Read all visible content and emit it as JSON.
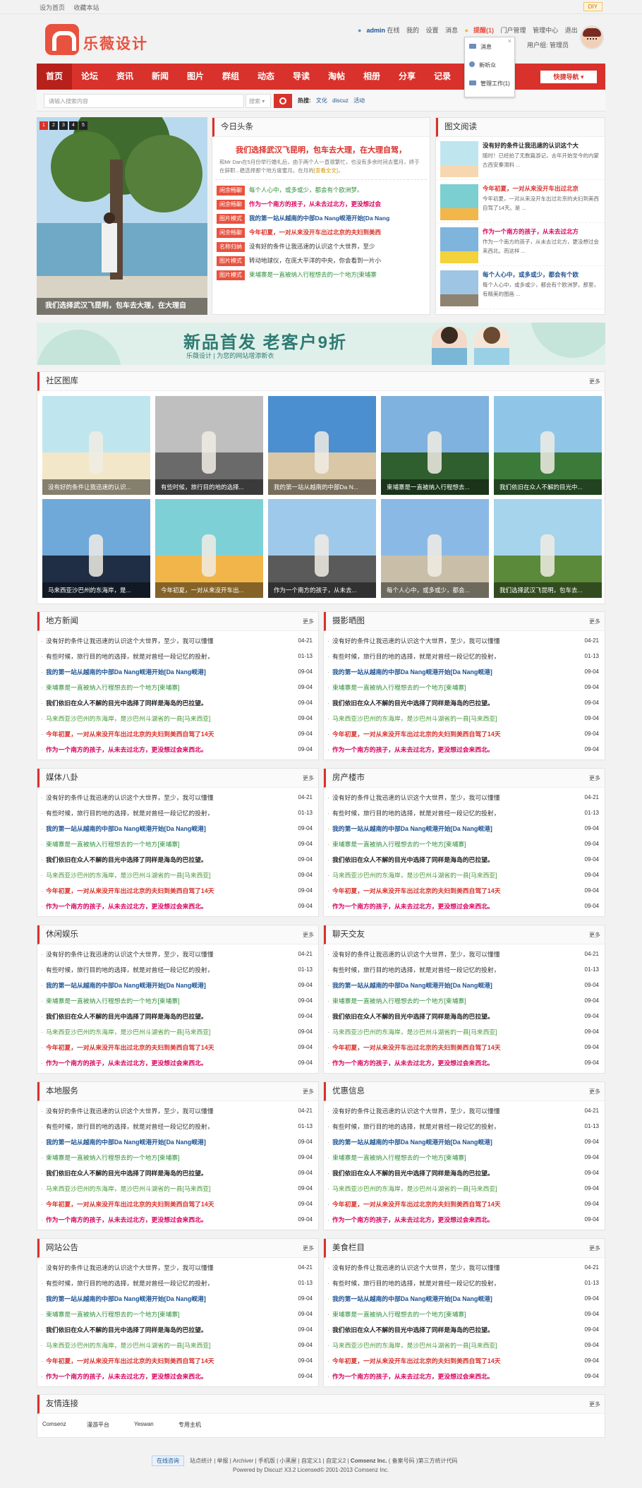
{
  "topbar": {
    "set_home": "设为首页",
    "bookmark": "收藏本站",
    "diy": "DIY"
  },
  "header": {
    "logo_text": "乐薇设计",
    "user": "admin",
    "online": "在线",
    "menu": [
      "我的",
      "设置",
      "消息"
    ],
    "remind": "提醒(1)",
    "manage": [
      "门户管理",
      "管理中心",
      "退出"
    ],
    "group_label": "用户组: 管理员"
  },
  "notif": {
    "items": [
      "消息",
      "新听众",
      "管理工作(1)"
    ]
  },
  "nav": {
    "items": [
      "首页",
      "论坛",
      "资讯",
      "新闻",
      "图片",
      "群组",
      "动态",
      "导读",
      "淘帖",
      "相册",
      "分享",
      "记录"
    ],
    "quick": "快捷导航"
  },
  "search": {
    "placeholder": "请输入搜索内容",
    "type": "搜索",
    "hot_label": "热搜:",
    "hot": [
      "文化",
      "discuz",
      "活动"
    ]
  },
  "slider": {
    "pages": [
      "1",
      "2",
      "3",
      "4",
      "5"
    ],
    "caption": "我们选择武汉飞昆明，包车去大理，在大理自"
  },
  "headline": {
    "title": "今日头条",
    "main_title": "我们选择武汉飞昆明，包车去大理，在大理自驾，",
    "desc_a": "和Mr Dan在5月份举行婚礼后，由于两个人一直很繁忙，也没有多余时间去蜜月，终于在",
    "desc_b": "辞职...",
    "desc_link": "[查看全文]",
    "desc_c": "，",
    "desc_d": "稳选择那个地方度蜜月。",
    "desc_e": "在月",
    "desc_f": "的",
    "rows": [
      {
        "tag": "闲余畅聊",
        "text": "每个人心中，或多或少，都会有个欧洲梦。",
        "cls": "c2"
      },
      {
        "tag": "闲余畅聊",
        "text": "作为一个南方的孩子，从未去过北方，更没想过会",
        "cls": "c6"
      },
      {
        "tag": "图片模式",
        "text": "我的第一站从越南的中部Da Nang岘港开始[Da Nang",
        "cls": "c1"
      },
      {
        "tag": "闲余畅聊",
        "text": "今年初夏，一对从来没开车出过北京的夫妇到美西",
        "cls": "c5"
      },
      {
        "tag": "名称归纳",
        "text": "没有好的条件让我迅速的认识这个大世界，至少",
        "cls": "c0"
      },
      {
        "tag": "图片模式",
        "text": "转动地球仪，在庞大平洋的中央，你会看到一片小",
        "cls": "c0"
      },
      {
        "tag": "图片模式",
        "text": "柬埔寨是一直被纳入行程想去的一个地方[柬埔寨",
        "cls": "c2"
      }
    ]
  },
  "picread": {
    "title": "图文阅读",
    "items": [
      {
        "t": "没有好的条件让我迅速的认识这个大",
        "cls": "c3",
        "d": "随时！已经拍了无数篇游记，去年开始至今的内蒙古西安秦渭料 ..."
      },
      {
        "t": "今年初夏，一对从来没开车出过北京",
        "cls": "c5",
        "d": "今年初夏，一对从来没开车出过北京的夫妇到美西自驾了14天。是 ..."
      },
      {
        "t": "作为一个南方的孩子，从未去过北方",
        "cls": "c6",
        "d": "作为一个南方的孩子，从未去过北方，更没想过会来西北。而这样 ..."
      },
      {
        "t": "每个人心中，或多或少，都会有个欧",
        "cls": "c1",
        "d": "每个人心中，或多或少，都会有个欧洲梦。那里，有精美的图画 ..."
      }
    ]
  },
  "banner": {
    "title": "新品首发  老客户9折",
    "subtitle": "乐薇设计 | 为您的网站增添新衣"
  },
  "gallery": {
    "title": "社区图库",
    "more": "更多",
    "items": [
      "没有好的条件让我迅速的认识...",
      "有些时候，旅行目的地的选择...",
      "我的第一站从越南的中部Da N...",
      "柬埔寨是一直被纳入行程想去...",
      "我们依旧在众人不解的目光中...",
      "马来西亚沙巴州的东海岸，是...",
      "今年初夏，一对从来没开车出...",
      "作为一个南方的孩子，从未去...",
      "每个人心中，或多或少，都会...",
      "我们选择武汉飞昆明，包车去..."
    ]
  },
  "news_rows": [
    {
      "t": "没有好的条件让我迅速的认识这个大世界，至少，我可以懂懂",
      "d": "04-21",
      "cls": "c0"
    },
    {
      "t": "有些时候，旅行目的地的选择，就是对曾经一段记忆的投射，",
      "d": "01-13",
      "cls": "c7"
    },
    {
      "t": "我的第一站从越南的中部Da Nang岘港开始[Da Nang岘港]",
      "d": "09-04",
      "cls": "c1"
    },
    {
      "t": "柬埔寨是一直被纳入行程想去的一个地方[柬埔寨]",
      "d": "09-04",
      "cls": "c2"
    },
    {
      "t": "我们依旧在众人不解的目光中选择了同样是海岛的巴拉望。",
      "d": "09-04",
      "cls": "c3"
    },
    {
      "t": "马来西亚沙巴州的东海岸，是沙巴州斗湖省的一县[马来西亚]",
      "d": "09-04",
      "cls": "c4"
    },
    {
      "t": "今年初夏，一对从来没开车出过北京的夫妇到美西自驾了14天",
      "d": "09-04",
      "cls": "c5"
    },
    {
      "t": "作为一个南方的孩子，从未去过北方，更没想过会来西北。",
      "d": "09-04",
      "cls": "c6"
    }
  ],
  "news_panels": [
    "地方新闻",
    "摄影晒图",
    "媒体八卦",
    "房产楼市",
    "休闲娱乐",
    "聊天交友",
    "本地服务",
    "优惠信息",
    "网站公告",
    "美食栏目"
  ],
  "links": {
    "title": "友情连接",
    "more": "更多",
    "items": [
      "Comsenz",
      "漫游平台",
      "Yeswan",
      "专用主机"
    ]
  },
  "footer": {
    "badge": "在线咨询",
    "line1": "站点统计 | 举报 | Archiver | 手机版 | 小黑屋 | 自定义1 | 自定义2 |",
    "company": "Comsenz Inc.",
    "line1b": "( 备案号码 )第三方统计代码",
    "line2": "Powered by Discuz! X3.2 Licensed© 2001-2013 Comsenz Inc."
  },
  "colors": {
    "brand_red": "#d9312b",
    "logo": "#e8523f",
    "link_blue": "#1e5494"
  }
}
